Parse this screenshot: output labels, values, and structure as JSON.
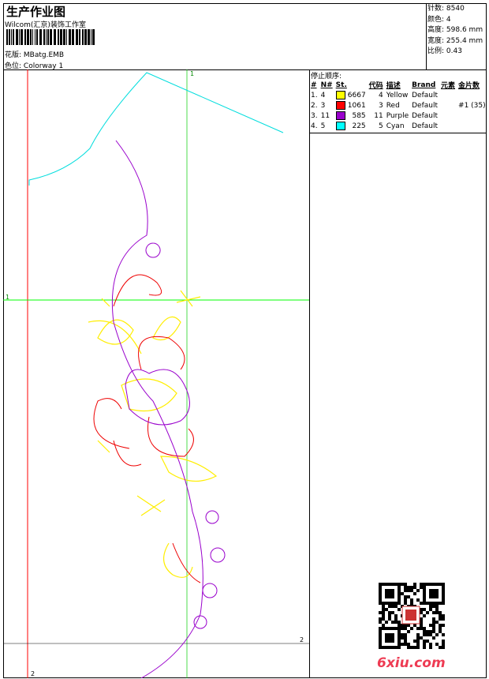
{
  "header": {
    "title": "生产作业图",
    "subtitle": "Wilcom(汇京)装饰工作室",
    "design_label": "花版:",
    "design_value": "MBatg.EMB",
    "colorway_label": "色位:",
    "colorway_value": "Colorway 1"
  },
  "info": [
    {
      "label": "针数:",
      "value": "8540"
    },
    {
      "label": "颜色:",
      "value": "4"
    },
    {
      "label": "高度:",
      "value": "598.6 mm"
    },
    {
      "label": "宽度:",
      "value": "255.4 mm"
    },
    {
      "label": "比例:",
      "value": "0.43"
    }
  ],
  "stops": {
    "title": "停止顺序:",
    "columns": [
      "#",
      "N#",
      "St.",
      "代码",
      "描述",
      "Brand",
      "元素",
      "金片数"
    ],
    "rows": [
      {
        "idx": "1.",
        "n": "4",
        "color": "#ffff00",
        "st": "6667",
        "code": "4",
        "desc": "Yellow",
        "brand": "Default",
        "elem": "",
        "seq": ""
      },
      {
        "idx": "2.",
        "n": "3",
        "color": "#ff0000",
        "st": "1061",
        "code": "3",
        "desc": "Red",
        "brand": "Default",
        "elem": "",
        "seq": "#1 (35)"
      },
      {
        "idx": "3.",
        "n": "11",
        "color": "#9900cc",
        "st": "585",
        "code": "11",
        "desc": "Purple",
        "brand": "Default",
        "elem": "",
        "seq": ""
      },
      {
        "idx": "4.",
        "n": "5",
        "color": "#00ffff",
        "st": "225",
        "code": "5",
        "desc": "Cyan",
        "brand": "Default",
        "elem": "",
        "seq": ""
      }
    ]
  },
  "guides": {
    "v1": "1",
    "h1": "1",
    "h2": "2",
    "v2": "2"
  },
  "watermark": "6xiu.com"
}
